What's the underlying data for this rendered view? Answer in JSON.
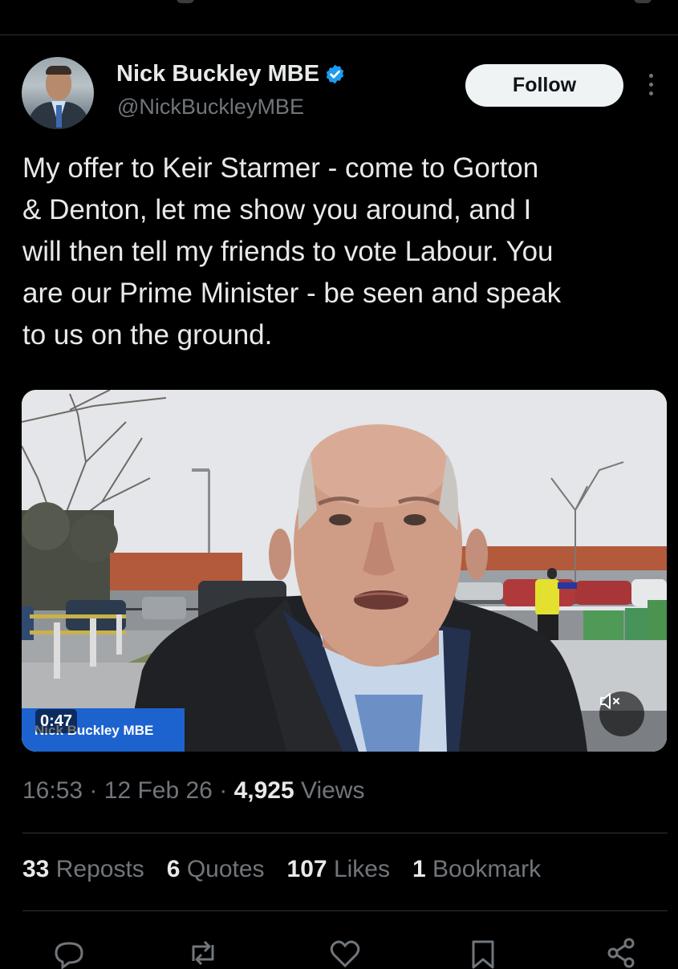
{
  "author": {
    "display_name": "Nick Buckley MBE",
    "handle": "@NickBuckleyMBE",
    "verified": true,
    "follow_label": "Follow"
  },
  "tweet": {
    "text": "My offer to Keir Starmer - come to Gorton\n& Denton, let me show you around, and I\nwill then tell my friends to vote Labour. You\nare our Prime Minister - be seen and speak\nto us on the ground."
  },
  "video": {
    "duration": "0:47",
    "caption_name": "Nick Buckley MBE",
    "mute_icon": "volume-muted-icon"
  },
  "meta": {
    "time": "16:53",
    "date": "12 Feb 26",
    "views_count": "4,925",
    "views_label": "Views",
    "separator": "·"
  },
  "stats": {
    "reposts_count": "33",
    "reposts_label": "Reposts",
    "quotes_count": "6",
    "quotes_label": "Quotes",
    "likes_count": "107",
    "likes_label": "Likes",
    "bookmarks_count": "1",
    "bookmarks_label": "Bookmark"
  },
  "actions": [
    "reply-icon",
    "repost-icon",
    "like-icon",
    "bookmark-icon",
    "share-icon"
  ],
  "colors": {
    "background": "#000000",
    "text": "#e7e9ea",
    "secondary_text": "#71767b",
    "verified": "#1d9bf0",
    "video_badge": "#1d63cf"
  }
}
